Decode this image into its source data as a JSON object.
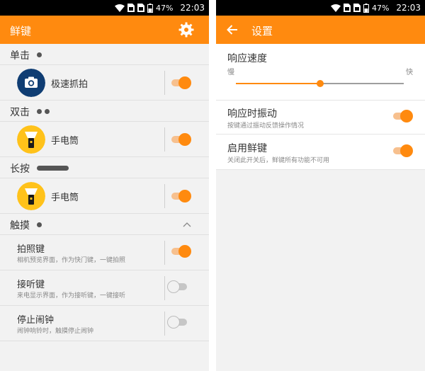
{
  "status_bar": {
    "battery": "47%",
    "time": "22:03"
  },
  "colors": {
    "accent": "#ff8a0f",
    "accent_light": "#f7c08e",
    "background": "#f2f2f2"
  },
  "left_screen": {
    "title": "鲜键",
    "sections": {
      "single": {
        "label": "单击",
        "app": "极速抓拍",
        "app_icon": "camera-icon",
        "enabled": true
      },
      "double": {
        "label": "双击",
        "app": "手电筒",
        "app_icon": "flashlight-icon",
        "enabled": true
      },
      "long": {
        "label": "长按",
        "app": "手电筒",
        "app_icon": "flashlight-icon",
        "enabled": true
      }
    },
    "touch": {
      "label": "触摸",
      "items": [
        {
          "title": "拍照键",
          "desc": "相机预览界面，作为快门键，一键拍照",
          "enabled": true
        },
        {
          "title": "接听键",
          "desc": "来电显示界面，作为接听键，一键接听",
          "enabled": false
        },
        {
          "title": "停止闹钟",
          "desc": "闹钟响铃时，触摸停止闹钟",
          "enabled": false
        }
      ]
    }
  },
  "right_screen": {
    "title": "设置",
    "speed": {
      "title": "响应速度",
      "min_label": "慢",
      "max_label": "快",
      "value_fraction": 0.5
    },
    "vibration": {
      "title": "响应时振动",
      "desc": "按键通过振动反馈操作情况",
      "enabled": true
    },
    "enable": {
      "title": "启用鲜键",
      "desc": "关闭此开关后，鲜键所有功能不可用",
      "enabled": true
    }
  }
}
